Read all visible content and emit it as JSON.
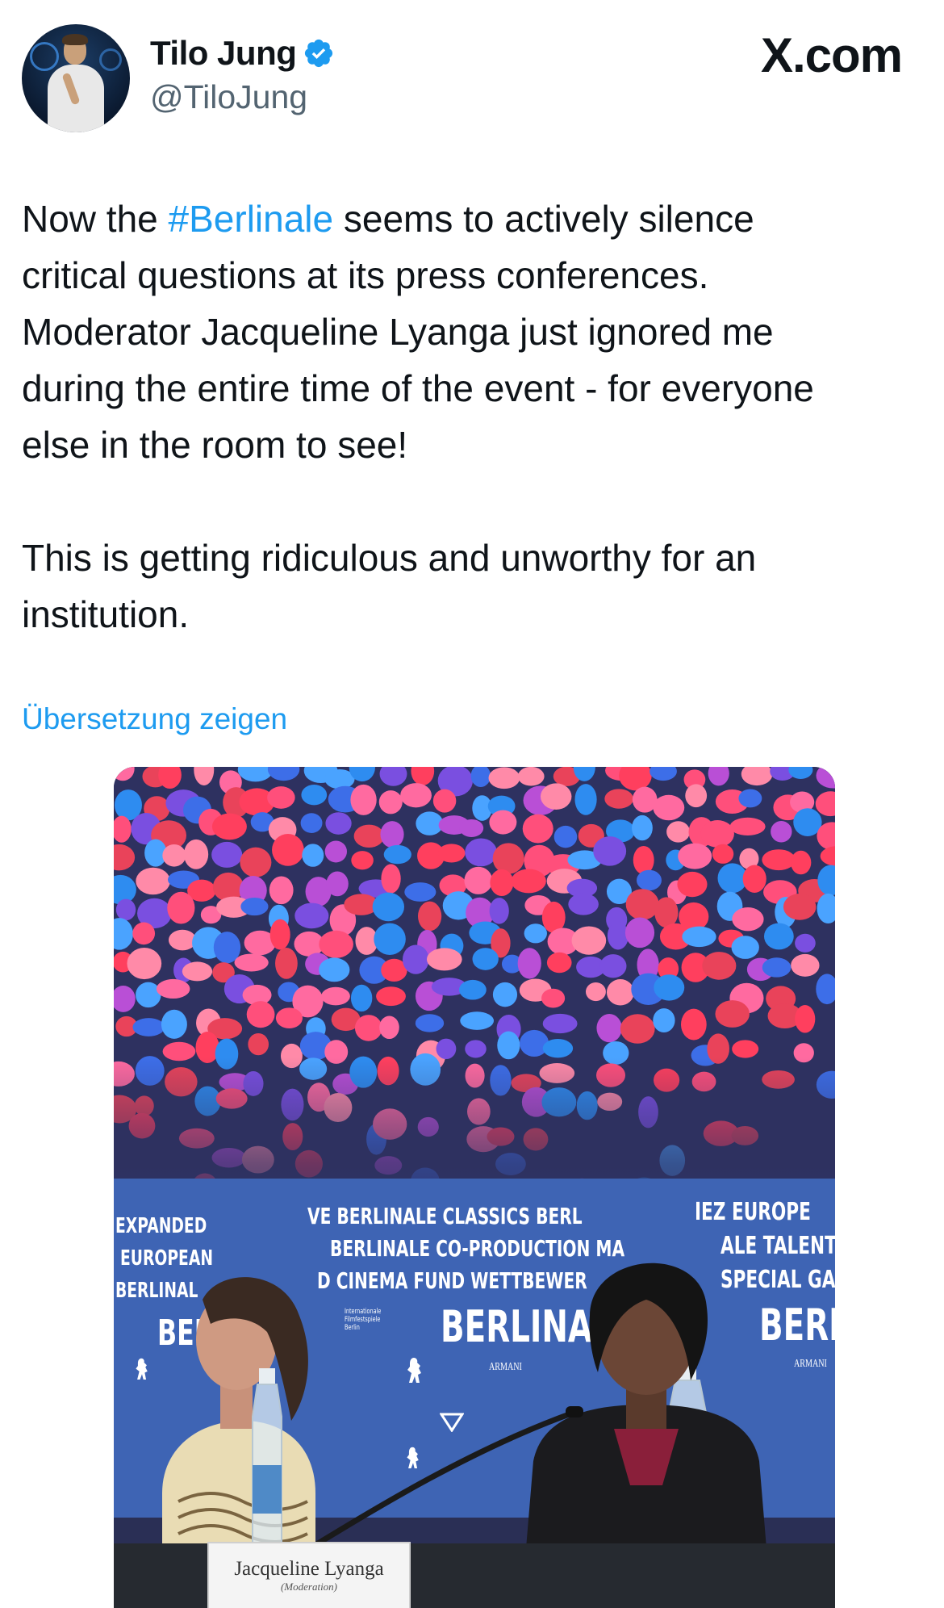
{
  "user": {
    "display_name": "Tilo Jung",
    "handle": "@TiloJung",
    "verified": true,
    "avatar_icon": "avatar-photo"
  },
  "site_label": "X.com",
  "tweet": {
    "text_before_tag": "Now the ",
    "hashtag": "#Berlinale",
    "text_after_tag": " seems to actively silence\ncritical questions at its press conferences.\nModerator Jacqueline Lyanga just ignored me\nduring the entire time of the event - for everyone\nelse in the room to see!\n\nThis is getting ridiculous and unworthy for an\ninstitution."
  },
  "translate_link": "Übersetzung zeigen",
  "photo": {
    "backdrop_texts": {
      "expanded": "EXPANDED",
      "european": "EUROPEAN",
      "berlinale_left": "BERLINAL",
      "ber_left": "BER",
      "ve_classics": "VE   BERLINALE CLASSICS   BERL",
      "coproduction": "BERLINALE CO-PRODUCTION MA",
      "cinema_fund": "D CINEMA FUND   WETTBEWER",
      "berlinale_center": "BERLINALE",
      "europe_right": "IEZ   EUROPE",
      "talents_right": "ALE TALENTS",
      "special_right": "SPECIAL GAL",
      "berl_right": "BERL",
      "armani": "ARMANI",
      "festival": "Internationale Filmfestspiele Berlin"
    },
    "nameplate": {
      "name": "Jacqueline Lyanga",
      "role": "(Moderation)"
    }
  },
  "colors": {
    "link": "#1d9bf0",
    "text": "#0f1419",
    "muted": "#536471",
    "backdrop_blue": "#3e64b4"
  }
}
